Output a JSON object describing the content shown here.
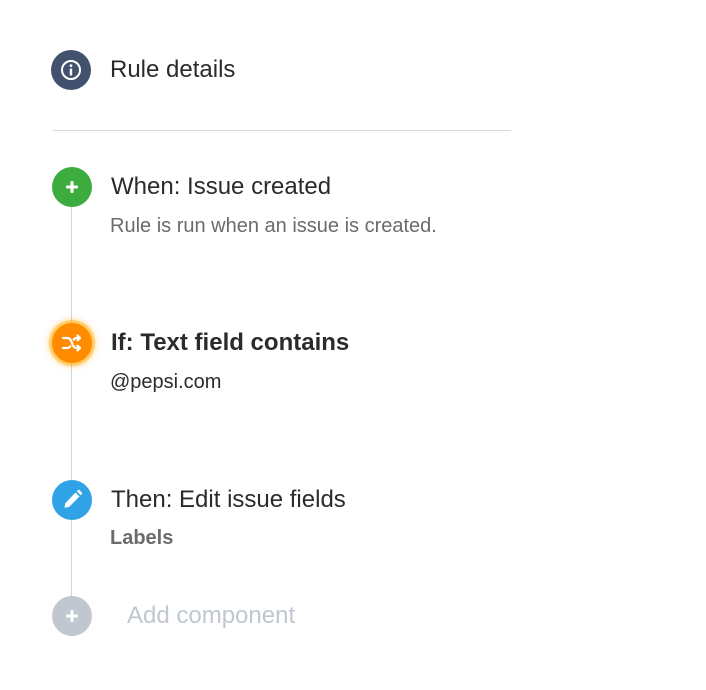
{
  "rule_details": {
    "label": "Rule details",
    "icon": "info-icon",
    "color": "#42526e"
  },
  "trigger": {
    "title": "When: Issue created",
    "description": "Rule is run when an issue is created.",
    "icon": "plus-icon",
    "color": "#3dac3f"
  },
  "condition": {
    "title": "If: Text field contains",
    "value": "@pepsi.com",
    "icon": "shuffle-icon",
    "color": "#ff8b00"
  },
  "action": {
    "title": "Then: Edit issue fields",
    "detail": "Labels",
    "icon": "pencil-icon",
    "color": "#2fa3e6"
  },
  "add_component": {
    "label": "Add component",
    "icon": "plus-icon",
    "color": "#c1c7d0"
  }
}
